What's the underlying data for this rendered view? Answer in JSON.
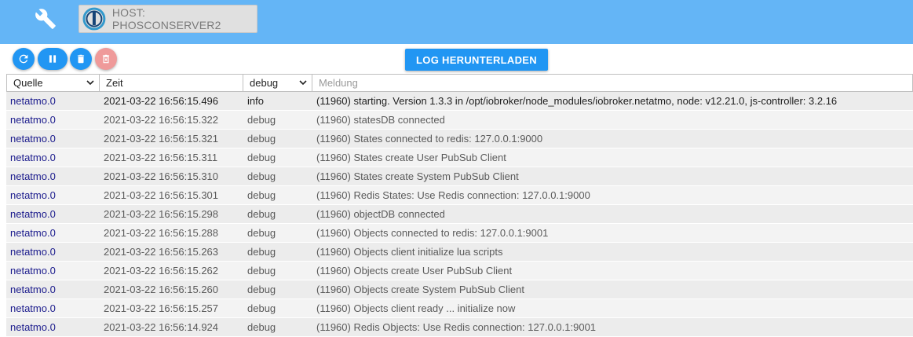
{
  "topbar": {
    "host_label": "HOST: PHOSCONSERVER2",
    "icons": [
      "wrench-icon",
      "iobroker-logo"
    ],
    "color": "#64b5f6"
  },
  "toolbar": {
    "buttons": [
      "refresh-icon",
      "pause-icon",
      "delete-icon",
      "delete-all-icon"
    ],
    "download_label": "LOG HERUNTERLADEN",
    "accent": "#2196f3",
    "disabled_color": "#ef9a9a"
  },
  "table": {
    "columns": {
      "source": "Quelle",
      "time": "Zeit",
      "severity": "debug",
      "message_placeholder": "Meldung"
    },
    "rows": [
      {
        "source": "netatmo.0",
        "time": "2021-03-22 16:56:15.496",
        "severity": "info",
        "message": "(11960) starting. Version 1.3.3 in /opt/iobroker/node_modules/iobroker.netatmo, node: v12.21.0, js-controller: 3.2.16"
      },
      {
        "source": "netatmo.0",
        "time": "2021-03-22 16:56:15.322",
        "severity": "debug",
        "message": "(11960) statesDB connected"
      },
      {
        "source": "netatmo.0",
        "time": "2021-03-22 16:56:15.321",
        "severity": "debug",
        "message": "(11960) States connected to redis: 127.0.0.1:9000"
      },
      {
        "source": "netatmo.0",
        "time": "2021-03-22 16:56:15.311",
        "severity": "debug",
        "message": "(11960) States create User PubSub Client"
      },
      {
        "source": "netatmo.0",
        "time": "2021-03-22 16:56:15.310",
        "severity": "debug",
        "message": "(11960) States create System PubSub Client"
      },
      {
        "source": "netatmo.0",
        "time": "2021-03-22 16:56:15.301",
        "severity": "debug",
        "message": "(11960) Redis States: Use Redis connection: 127.0.0.1:9000"
      },
      {
        "source": "netatmo.0",
        "time": "2021-03-22 16:56:15.298",
        "severity": "debug",
        "message": "(11960) objectDB connected"
      },
      {
        "source": "netatmo.0",
        "time": "2021-03-22 16:56:15.288",
        "severity": "debug",
        "message": "(11960) Objects connected to redis: 127.0.0.1:9001"
      },
      {
        "source": "netatmo.0",
        "time": "2021-03-22 16:56:15.263",
        "severity": "debug",
        "message": "(11960) Objects client initialize lua scripts"
      },
      {
        "source": "netatmo.0",
        "time": "2021-03-22 16:56:15.262",
        "severity": "debug",
        "message": "(11960) Objects create User PubSub Client"
      },
      {
        "source": "netatmo.0",
        "time": "2021-03-22 16:56:15.260",
        "severity": "debug",
        "message": "(11960) Objects create System PubSub Client"
      },
      {
        "source": "netatmo.0",
        "time": "2021-03-22 16:56:15.257",
        "severity": "debug",
        "message": "(11960) Objects client ready ... initialize now"
      },
      {
        "source": "netatmo.0",
        "time": "2021-03-22 16:56:14.924",
        "severity": "debug",
        "message": "(11960) Redis Objects: Use Redis connection: 127.0.0.1:9001"
      }
    ]
  }
}
